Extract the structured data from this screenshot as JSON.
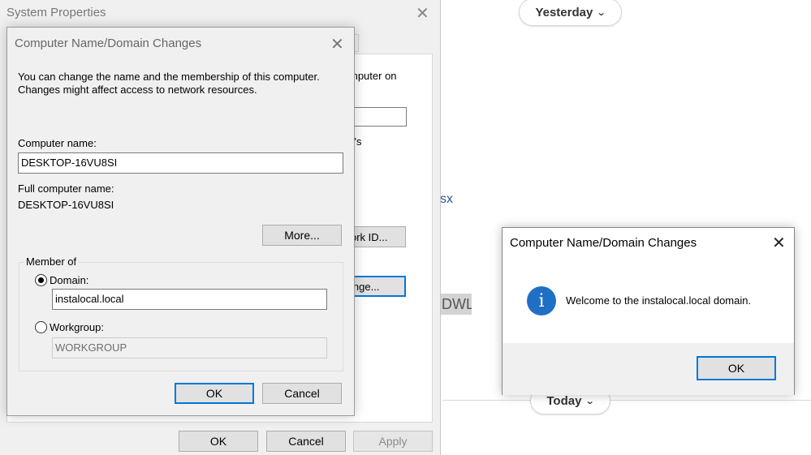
{
  "background": {
    "pill_yesterday": "Yesterday",
    "pill_today": "Today",
    "chevron": "⌄",
    "file_fragment": "sx",
    "user_fragment": "DWL"
  },
  "system_properties": {
    "title": "System Properties",
    "close": "✕",
    "peek_text_1": "mputer on",
    "peek_text_2": "y's",
    "peek_btn_network": "ork ID...",
    "peek_btn_change": "inge...",
    "ok_label": "OK",
    "cancel_label": "Cancel",
    "apply_label": "Apply"
  },
  "name_dialog": {
    "title": "Computer Name/Domain Changes",
    "close": "✕",
    "intro_line1": "You can change the name and the membership of this computer.",
    "intro_line2": "Changes might affect access to network resources.",
    "computer_name_label": "Computer name:",
    "computer_name_value": "DESKTOP-16VU8SI",
    "full_name_label": "Full computer name:",
    "full_name_value": "DESKTOP-16VU8SI",
    "more_label": "More...",
    "member_of_label": "Member of",
    "domain_label": "Domain:",
    "domain_value": "instalocal.local",
    "domain_selected": true,
    "workgroup_label": "Workgroup:",
    "workgroup_value": "WORKGROUP",
    "ok_label": "OK",
    "cancel_label": "Cancel"
  },
  "welcome_box": {
    "title": "Computer Name/Domain Changes",
    "close": "✕",
    "icon_glyph": "i",
    "message": "Welcome to the instalocal.local domain.",
    "ok_label": "OK"
  }
}
